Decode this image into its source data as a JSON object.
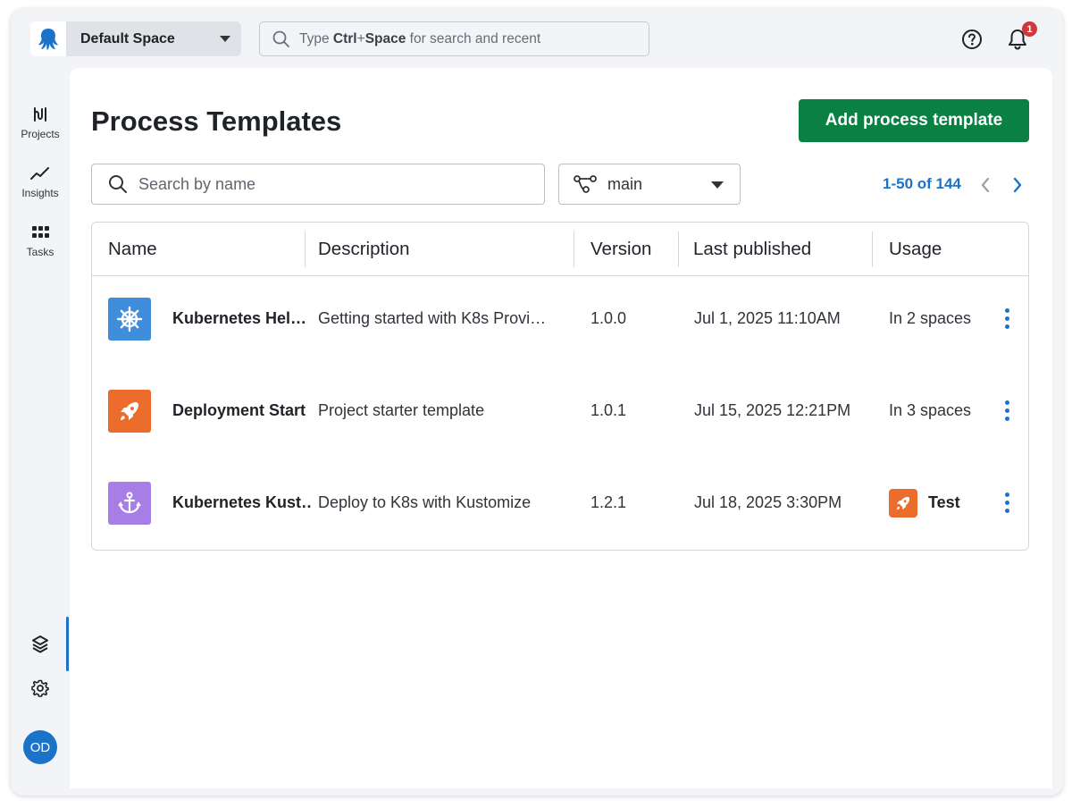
{
  "topbar": {
    "space_name": "Default Space",
    "search_prefix": "Type ",
    "search_key1": "Ctrl",
    "search_plus": "+",
    "search_key2": "Space",
    "search_suffix": " for search and recent",
    "notification_count": "1"
  },
  "nav": {
    "items": [
      {
        "label": "Projects",
        "icon": "projects-icon"
      },
      {
        "label": "Insights",
        "icon": "insights-icon"
      },
      {
        "label": "Tasks",
        "icon": "tasks-icon"
      }
    ],
    "bottom_icons": [
      "layers-icon",
      "gear-icon"
    ],
    "avatar_initials": "OD"
  },
  "main": {
    "title": "Process Templates",
    "add_button_label": "Add process template",
    "search_placeholder": "Search by name",
    "branch": "main",
    "pagination": "1-50 of 144"
  },
  "table": {
    "columns": [
      "Name",
      "Description",
      "Version",
      "Last published",
      "Usage"
    ],
    "rows": [
      {
        "name": "Kubernetes Hel…",
        "description": "Getting started with K8s Provi…",
        "version": "1.0.0",
        "last_published": "Jul 1, 2025 11:10AM",
        "usage": "In 2 spaces",
        "icon": "helm-wheel-icon",
        "icon_color": "#3e8edb"
      },
      {
        "name": "Deployment Start",
        "description": "Project starter template",
        "version": "1.0.1",
        "last_published": "Jul 15, 2025 12:21PM",
        "usage": "In 3 spaces",
        "icon": "rocket-icon",
        "icon_color": "#ec6c2c"
      },
      {
        "name": "Kubernetes Kust…",
        "description": "Deploy to K8s with Kustomize",
        "version": "1.2.1",
        "last_published": "Jul 18, 2025 3:30PM",
        "usage": "Test",
        "icon": "anchor-icon",
        "icon_color": "#a67ee6"
      }
    ]
  },
  "colors": {
    "accent": "#1a73c8",
    "primary_button": "#0a8043",
    "badge": "#d0383a"
  }
}
